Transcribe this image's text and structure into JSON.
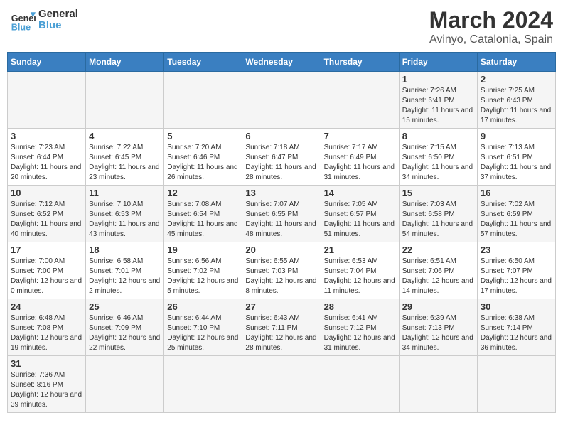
{
  "header": {
    "logo_general": "General",
    "logo_blue": "Blue",
    "title": "March 2024",
    "location": "Avinyo, Catalonia, Spain"
  },
  "days_of_week": [
    "Sunday",
    "Monday",
    "Tuesday",
    "Wednesday",
    "Thursday",
    "Friday",
    "Saturday"
  ],
  "weeks": [
    [
      {
        "day": "",
        "info": ""
      },
      {
        "day": "",
        "info": ""
      },
      {
        "day": "",
        "info": ""
      },
      {
        "day": "",
        "info": ""
      },
      {
        "day": "",
        "info": ""
      },
      {
        "day": "1",
        "info": "Sunrise: 7:26 AM\nSunset: 6:41 PM\nDaylight: 11 hours and 15 minutes."
      },
      {
        "day": "2",
        "info": "Sunrise: 7:25 AM\nSunset: 6:43 PM\nDaylight: 11 hours and 17 minutes."
      }
    ],
    [
      {
        "day": "3",
        "info": "Sunrise: 7:23 AM\nSunset: 6:44 PM\nDaylight: 11 hours and 20 minutes."
      },
      {
        "day": "4",
        "info": "Sunrise: 7:22 AM\nSunset: 6:45 PM\nDaylight: 11 hours and 23 minutes."
      },
      {
        "day": "5",
        "info": "Sunrise: 7:20 AM\nSunset: 6:46 PM\nDaylight: 11 hours and 26 minutes."
      },
      {
        "day": "6",
        "info": "Sunrise: 7:18 AM\nSunset: 6:47 PM\nDaylight: 11 hours and 28 minutes."
      },
      {
        "day": "7",
        "info": "Sunrise: 7:17 AM\nSunset: 6:49 PM\nDaylight: 11 hours and 31 minutes."
      },
      {
        "day": "8",
        "info": "Sunrise: 7:15 AM\nSunset: 6:50 PM\nDaylight: 11 hours and 34 minutes."
      },
      {
        "day": "9",
        "info": "Sunrise: 7:13 AM\nSunset: 6:51 PM\nDaylight: 11 hours and 37 minutes."
      }
    ],
    [
      {
        "day": "10",
        "info": "Sunrise: 7:12 AM\nSunset: 6:52 PM\nDaylight: 11 hours and 40 minutes."
      },
      {
        "day": "11",
        "info": "Sunrise: 7:10 AM\nSunset: 6:53 PM\nDaylight: 11 hours and 43 minutes."
      },
      {
        "day": "12",
        "info": "Sunrise: 7:08 AM\nSunset: 6:54 PM\nDaylight: 11 hours and 45 minutes."
      },
      {
        "day": "13",
        "info": "Sunrise: 7:07 AM\nSunset: 6:55 PM\nDaylight: 11 hours and 48 minutes."
      },
      {
        "day": "14",
        "info": "Sunrise: 7:05 AM\nSunset: 6:57 PM\nDaylight: 11 hours and 51 minutes."
      },
      {
        "day": "15",
        "info": "Sunrise: 7:03 AM\nSunset: 6:58 PM\nDaylight: 11 hours and 54 minutes."
      },
      {
        "day": "16",
        "info": "Sunrise: 7:02 AM\nSunset: 6:59 PM\nDaylight: 11 hours and 57 minutes."
      }
    ],
    [
      {
        "day": "17",
        "info": "Sunrise: 7:00 AM\nSunset: 7:00 PM\nDaylight: 12 hours and 0 minutes."
      },
      {
        "day": "18",
        "info": "Sunrise: 6:58 AM\nSunset: 7:01 PM\nDaylight: 12 hours and 2 minutes."
      },
      {
        "day": "19",
        "info": "Sunrise: 6:56 AM\nSunset: 7:02 PM\nDaylight: 12 hours and 5 minutes."
      },
      {
        "day": "20",
        "info": "Sunrise: 6:55 AM\nSunset: 7:03 PM\nDaylight: 12 hours and 8 minutes."
      },
      {
        "day": "21",
        "info": "Sunrise: 6:53 AM\nSunset: 7:04 PM\nDaylight: 12 hours and 11 minutes."
      },
      {
        "day": "22",
        "info": "Sunrise: 6:51 AM\nSunset: 7:06 PM\nDaylight: 12 hours and 14 minutes."
      },
      {
        "day": "23",
        "info": "Sunrise: 6:50 AM\nSunset: 7:07 PM\nDaylight: 12 hours and 17 minutes."
      }
    ],
    [
      {
        "day": "24",
        "info": "Sunrise: 6:48 AM\nSunset: 7:08 PM\nDaylight: 12 hours and 19 minutes."
      },
      {
        "day": "25",
        "info": "Sunrise: 6:46 AM\nSunset: 7:09 PM\nDaylight: 12 hours and 22 minutes."
      },
      {
        "day": "26",
        "info": "Sunrise: 6:44 AM\nSunset: 7:10 PM\nDaylight: 12 hours and 25 minutes."
      },
      {
        "day": "27",
        "info": "Sunrise: 6:43 AM\nSunset: 7:11 PM\nDaylight: 12 hours and 28 minutes."
      },
      {
        "day": "28",
        "info": "Sunrise: 6:41 AM\nSunset: 7:12 PM\nDaylight: 12 hours and 31 minutes."
      },
      {
        "day": "29",
        "info": "Sunrise: 6:39 AM\nSunset: 7:13 PM\nDaylight: 12 hours and 34 minutes."
      },
      {
        "day": "30",
        "info": "Sunrise: 6:38 AM\nSunset: 7:14 PM\nDaylight: 12 hours and 36 minutes."
      }
    ],
    [
      {
        "day": "31",
        "info": "Sunrise: 7:36 AM\nSunset: 8:16 PM\nDaylight: 12 hours and 39 minutes."
      },
      {
        "day": "",
        "info": ""
      },
      {
        "day": "",
        "info": ""
      },
      {
        "day": "",
        "info": ""
      },
      {
        "day": "",
        "info": ""
      },
      {
        "day": "",
        "info": ""
      },
      {
        "day": "",
        "info": ""
      }
    ]
  ]
}
